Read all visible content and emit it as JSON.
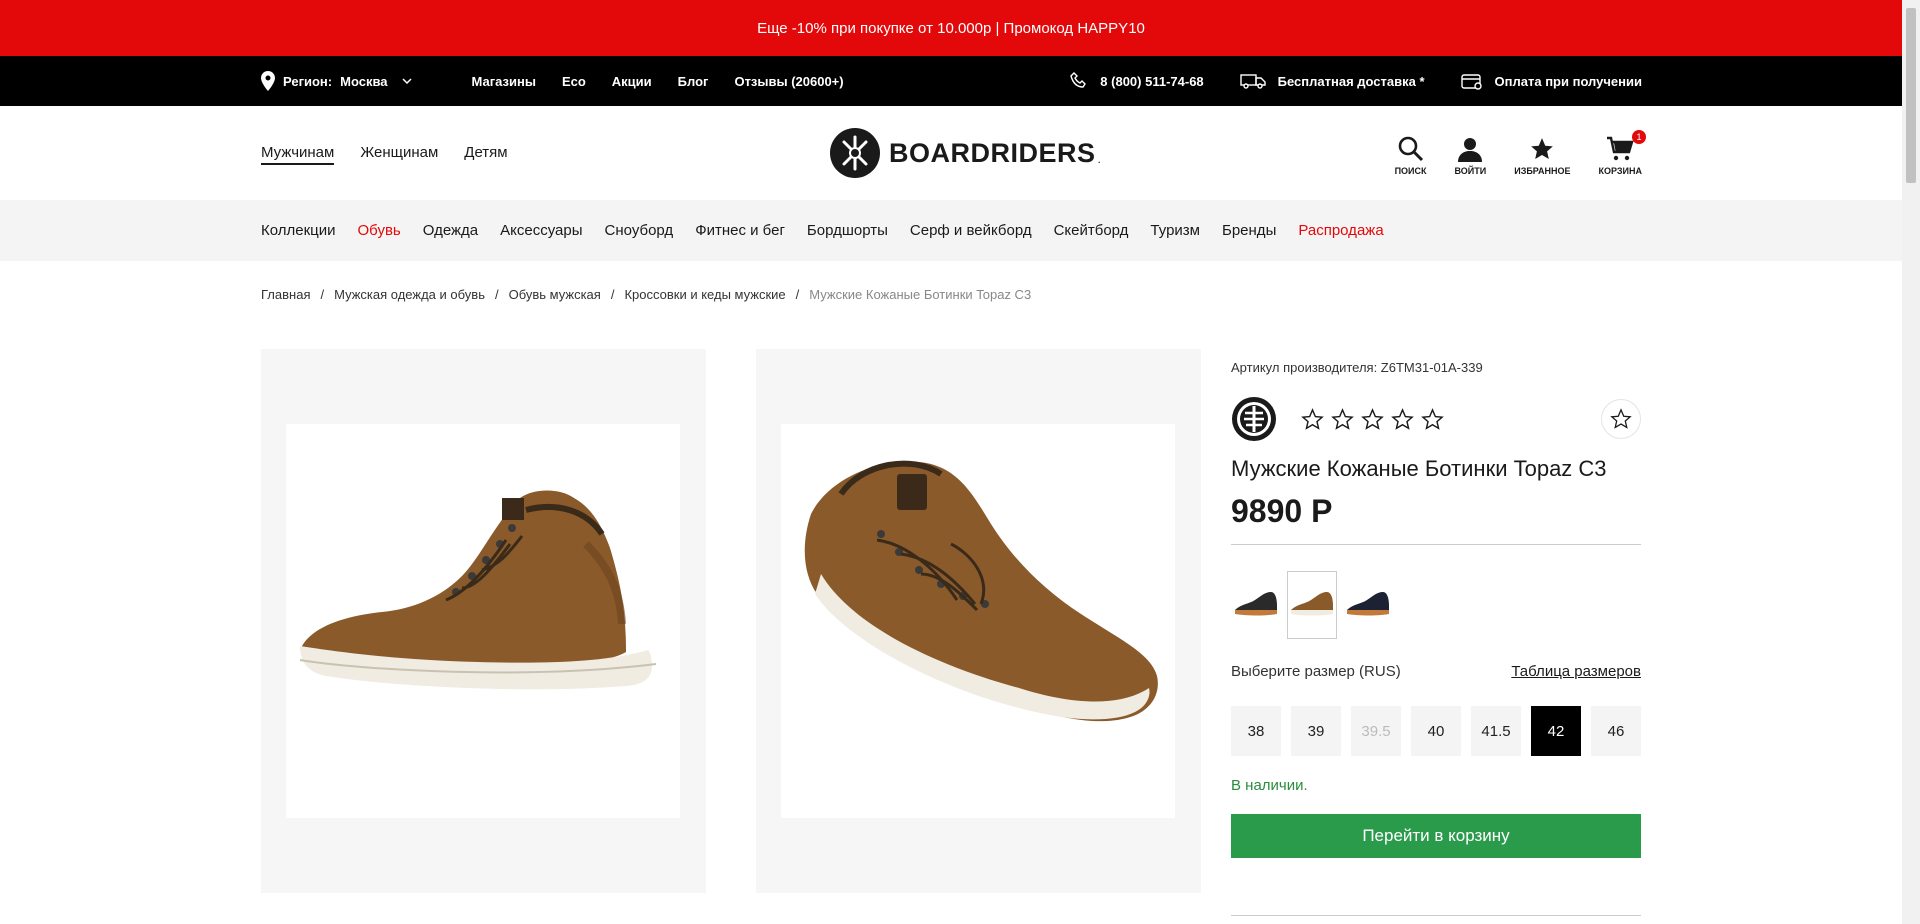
{
  "promo": {
    "text": "Еще -10% при покупке от 10.000р | Промокод HAPPY10"
  },
  "topbar": {
    "region_label": "Регион:",
    "region_value": "Москва",
    "links": [
      "Магазины",
      "Eco",
      "Акции",
      "Блог",
      "Отзывы (20600+)"
    ],
    "phone": "8 (800) 511-74-68",
    "delivery": "Бесплатная доставка *",
    "payment": "Оплата при получении"
  },
  "header": {
    "gender": [
      "Мужчинам",
      "Женщинам",
      "Детям"
    ],
    "logo_text": "BOARDRIDERS",
    "logo_mark": ".",
    "icons": {
      "search": "поиск",
      "login": "войти",
      "favorites": "избранное",
      "cart": "корзина",
      "cart_count": "1"
    }
  },
  "catnav": [
    "Коллекции",
    "Обувь",
    "Одежда",
    "Аксессуары",
    "Сноуборд",
    "Фитнес и бег",
    "Бордшорты",
    "Серф и вейкборд",
    "Скейтборд",
    "Туризм",
    "Бренды",
    "Распродажа"
  ],
  "breadcrumbs": [
    "Главная",
    "Мужская одежда и обувь",
    "Обувь мужская",
    "Кроссовки и кеды мужские",
    "Мужские Кожаные Ботинки Topaz C3"
  ],
  "breadcrumb_sep": "/",
  "product": {
    "sku": "Артикул производителя: Z6TM31-01A-339",
    "title": "Мужские Кожаные Ботинки Topaz C3",
    "price": "9890 Р",
    "size_label": "Выберите размер (RUS)",
    "size_table_link": "Таблица размеров",
    "sizes": [
      "38",
      "39",
      "39.5",
      "40",
      "41.5",
      "42",
      "46"
    ],
    "stock": "В наличии.",
    "cta": "Перейти в корзину"
  },
  "colors": {
    "promo_red": "#e3090b",
    "cta_green": "#2a9b4b",
    "stock_green": "#2a8c3c",
    "suede": "#8b5a2b"
  }
}
